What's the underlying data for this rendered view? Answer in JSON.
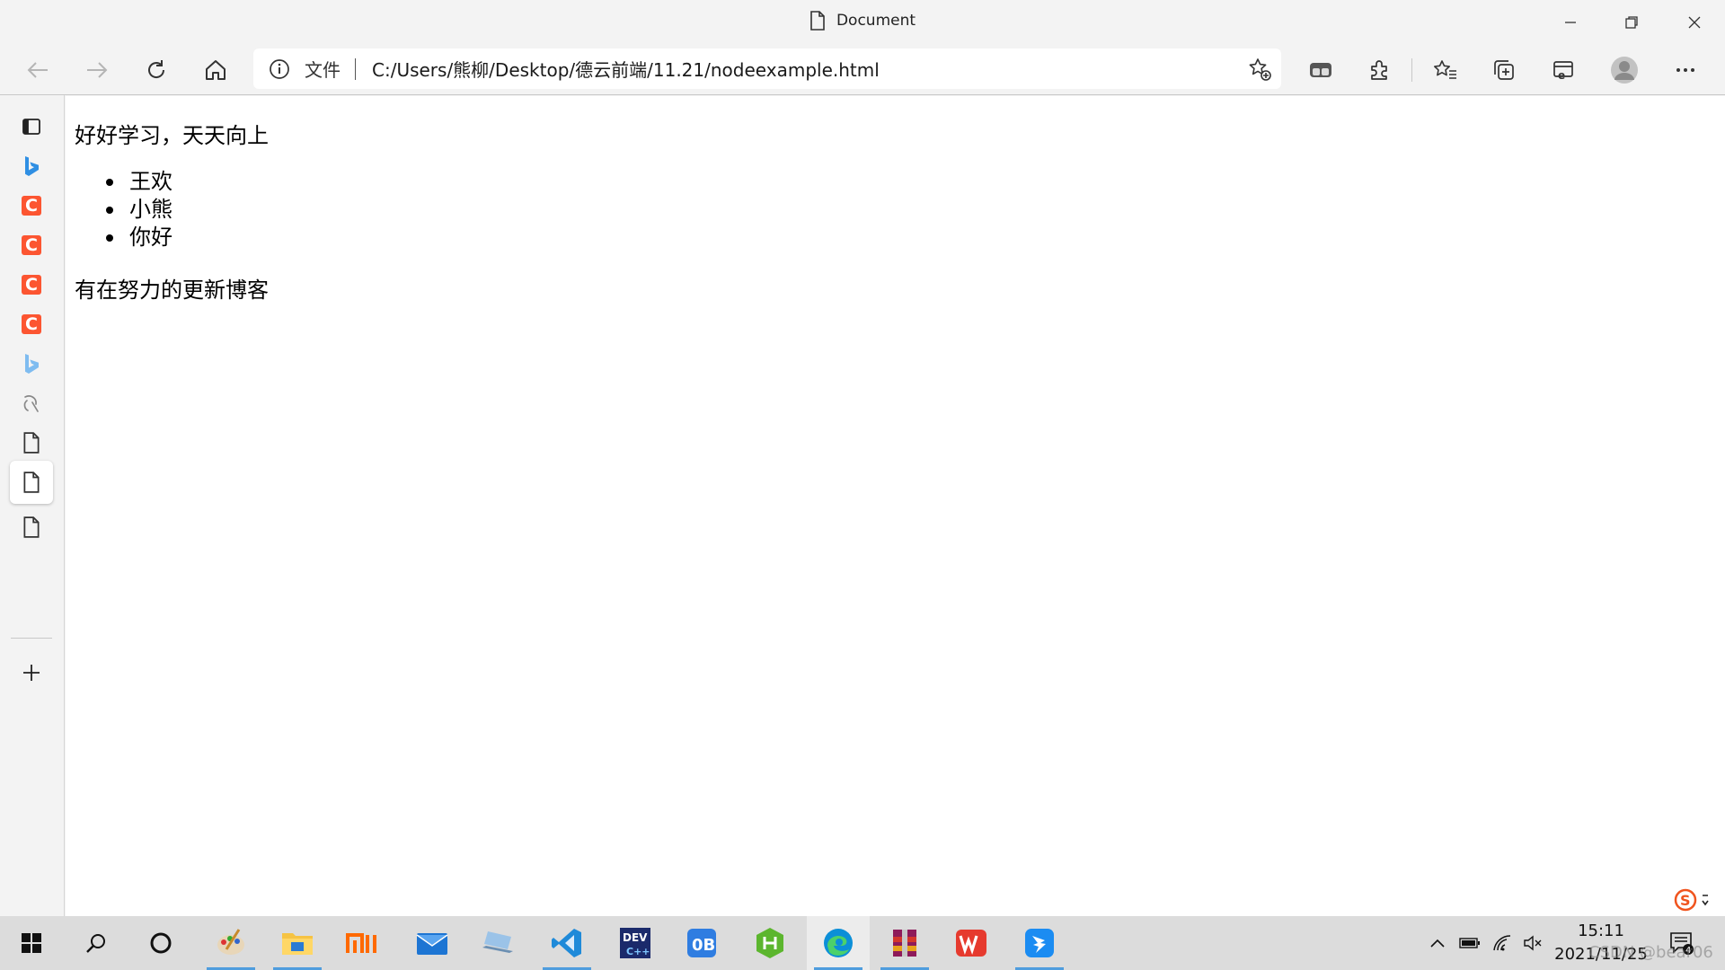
{
  "window": {
    "tab_title": "Document"
  },
  "toolbar": {
    "scheme_label": "文件",
    "url": "C:/Users/熊柳/Desktop/德云前端/11.21/nodeexample.html"
  },
  "page": {
    "heading_line": "好好学习，天天向上",
    "list_items": [
      "王欢",
      "小熊",
      "你好"
    ],
    "footer_line": "有在努力的更新博客"
  },
  "taskbar": {
    "clock_time": "15:11",
    "clock_date": "2021/11/25",
    "notification_count": "4",
    "watermark": "CSDN @bear06"
  },
  "colors": {
    "csdn_red": "#fc5531",
    "edge_blue": "#0078d4",
    "accent_underline": "#4f9dde"
  }
}
